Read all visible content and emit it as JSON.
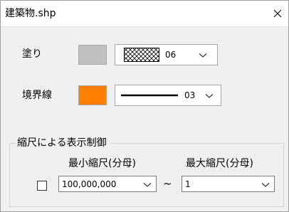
{
  "window": {
    "title": "建築物.shp",
    "close_label": "×"
  },
  "fill": {
    "label": "塗り",
    "swatch_color": "#c0c0c0",
    "pattern_value": "06",
    "pattern_icon": "crosshatch-pattern-icon"
  },
  "border": {
    "label": "境界線",
    "swatch_color": "#ff7f00",
    "line_value": "03",
    "line_icon": "solid-line-icon"
  },
  "scale_control": {
    "group_label": "縮尺による表示制御",
    "checked": false,
    "min_label": "最小縮尺(分母)",
    "max_label": "最大縮尺(分母)",
    "min_value": "100,000,000",
    "max_value": "1",
    "range_separator": "~"
  }
}
